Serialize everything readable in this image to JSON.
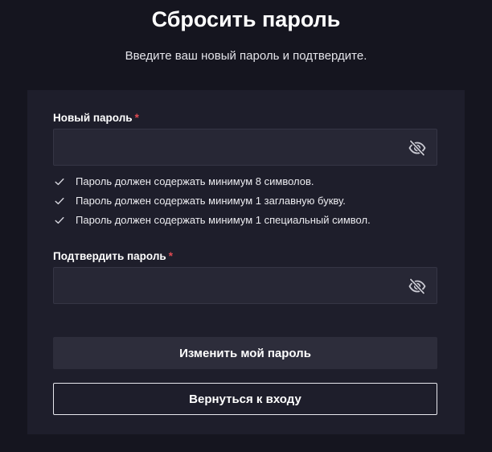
{
  "page": {
    "title": "Сбросить пароль",
    "subtitle": "Введите ваш новый пароль и подтвердите."
  },
  "form": {
    "new_password": {
      "label": "Новый пароль",
      "required_mark": "*",
      "value": "",
      "placeholder": "",
      "toggle_icon": "eye-slash-icon"
    },
    "rules": [
      {
        "text": "Пароль должен содержать минимум 8 символов.",
        "icon": "check-icon"
      },
      {
        "text": "Пароль должен содержать минимум 1 заглавную букву.",
        "icon": "check-icon"
      },
      {
        "text": "Пароль должен содержать минимум 1 специальный символ.",
        "icon": "check-icon"
      }
    ],
    "confirm_password": {
      "label": "Подтвердить пароль",
      "required_mark": "*",
      "value": "",
      "placeholder": "",
      "toggle_icon": "eye-slash-icon"
    },
    "submit_label": "Изменить мой пароль",
    "back_label": "Вернуться к входу"
  },
  "colors": {
    "background": "#15151f",
    "card": "#1e1e2b",
    "field": "#272735",
    "primary_button": "#2d2d3b",
    "required": "#e04a52"
  }
}
